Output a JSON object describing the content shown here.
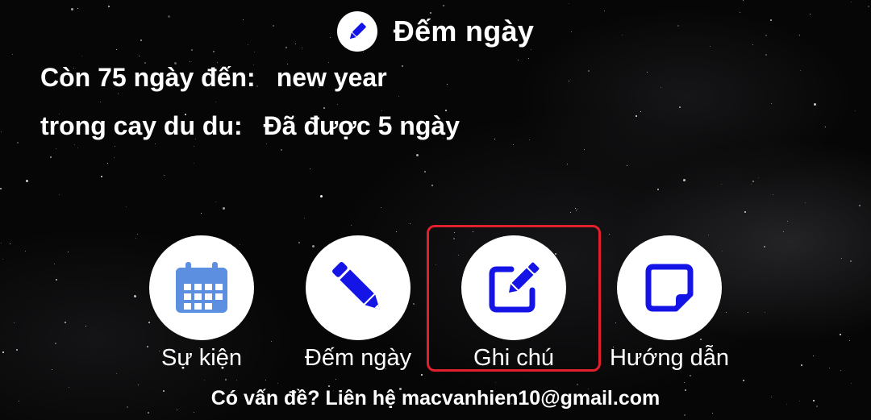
{
  "header": {
    "title": "Đếm ngày",
    "icon": "pencil-icon"
  },
  "countdowns": [
    {
      "label": "Còn 75 ngày đến:",
      "value": "new year"
    },
    {
      "label": "trong cay du du:",
      "value": "Đã được 5 ngày"
    }
  ],
  "nav": [
    {
      "label": "Sự kiện",
      "icon": "calendar-icon",
      "color": "#5c8fe0"
    },
    {
      "label": "Đếm ngày",
      "icon": "pencil-icon",
      "color": "#1414e6"
    },
    {
      "label": "Ghi chú",
      "icon": "edit-note-icon",
      "color": "#1414e6",
      "highlighted": true
    },
    {
      "label": "Hướng dẫn",
      "icon": "sticky-note-icon",
      "color": "#1414e6"
    }
  ],
  "footer": {
    "text": "Có vấn đề? Liên hệ macvanhien10@gmail.com"
  },
  "colors": {
    "highlight": "#e0202c",
    "accent": "#1414e6",
    "calendar": "#5c8fe0"
  }
}
